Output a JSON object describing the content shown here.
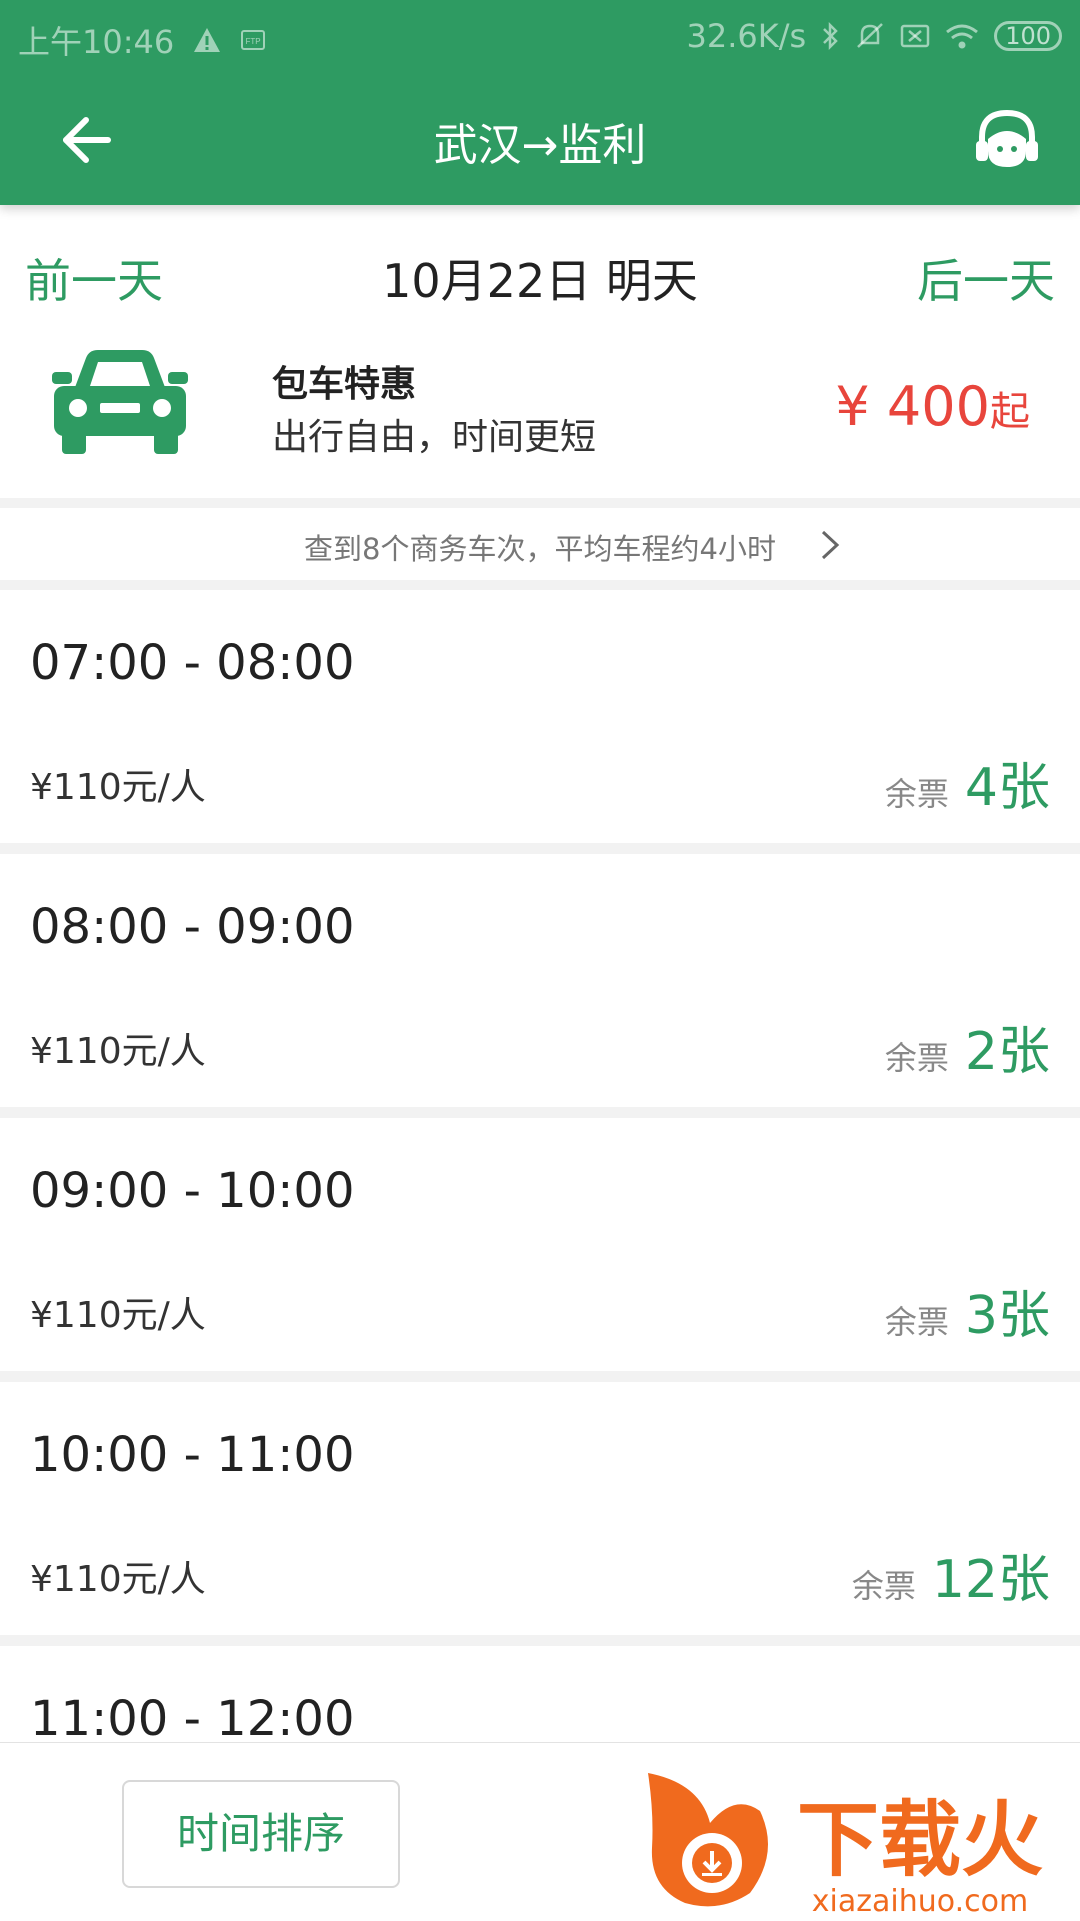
{
  "status_bar": {
    "time": "上午10:46",
    "network_speed": "32.6K/s",
    "battery": "100"
  },
  "header": {
    "title": "武汉→监利",
    "back_icon": "arrow-left-icon",
    "service_icon": "customer-service-icon"
  },
  "date_nav": {
    "prev_label": "前一天",
    "current": "10月22日 明天",
    "next_label": "后一天"
  },
  "charter": {
    "icon": "car-icon",
    "title": "包车特惠",
    "subtitle": "出行自由，时间更短",
    "price": "¥ 400",
    "price_suffix": "起"
  },
  "summary": {
    "text": "查到8个商务车次，平均车程约4小时"
  },
  "trips": [
    {
      "time": "07:00 - 08:00",
      "price": "¥110元/人",
      "remaining_label": "余票",
      "remaining_count": "4张"
    },
    {
      "time": "08:00 - 09:00",
      "price": "¥110元/人",
      "remaining_label": "余票",
      "remaining_count": "2张"
    },
    {
      "time": "09:00 - 10:00",
      "price": "¥110元/人",
      "remaining_label": "余票",
      "remaining_count": "3张"
    },
    {
      "time": "10:00 - 11:00",
      "price": "¥110元/人",
      "remaining_label": "余票",
      "remaining_count": "12张"
    },
    {
      "time": "11:00 - 12:00"
    }
  ],
  "bottom": {
    "sort_label": "时间排序",
    "watermark_title": "下载火",
    "watermark_url": "xiazaihuo.com"
  },
  "colors": {
    "primary_green": "#2e9b62",
    "price_red": "#e8453c",
    "watermark_orange": "#f06a1e"
  }
}
